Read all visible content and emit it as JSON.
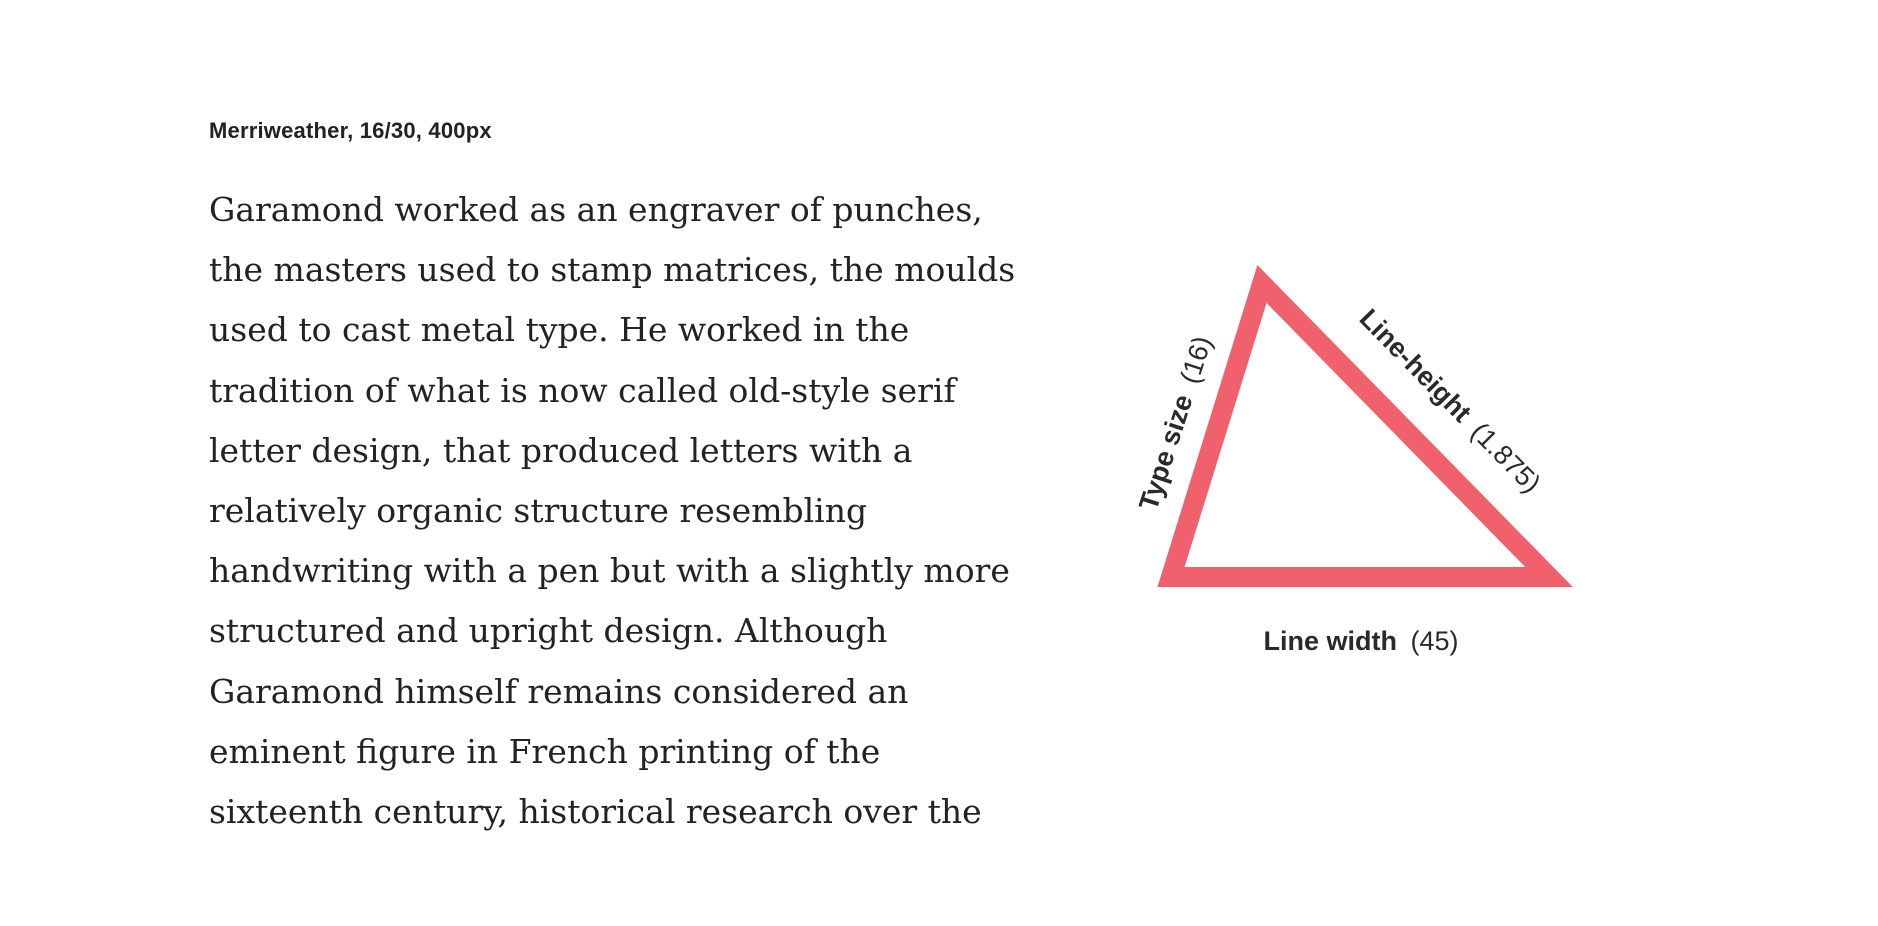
{
  "spec_caption": "Merriweather, 16/30, 400px",
  "paragraph_lines": [
    "Garamond worked as an engraver of punches,",
    "the masters used to stamp matrices, the moulds",
    "used to cast metal type. He worked in the",
    "tradition of what is now called old-style serif",
    "letter design, that produced letters with a",
    "relatively organic structure resembling",
    "handwriting with a pen but with a slightly more",
    "structured and upright design. Although",
    "Garamond himself remains considered an",
    "eminent figure in French printing of the",
    "sixteenth century, historical research over the"
  ],
  "triangle": {
    "stroke_color": "#f0616d",
    "type_size": {
      "label": "Type size",
      "value": "(16)"
    },
    "line_height": {
      "label": "Line-height",
      "value": "(1.875)"
    },
    "line_width": {
      "label": "Line width",
      "value": "(45)"
    }
  }
}
